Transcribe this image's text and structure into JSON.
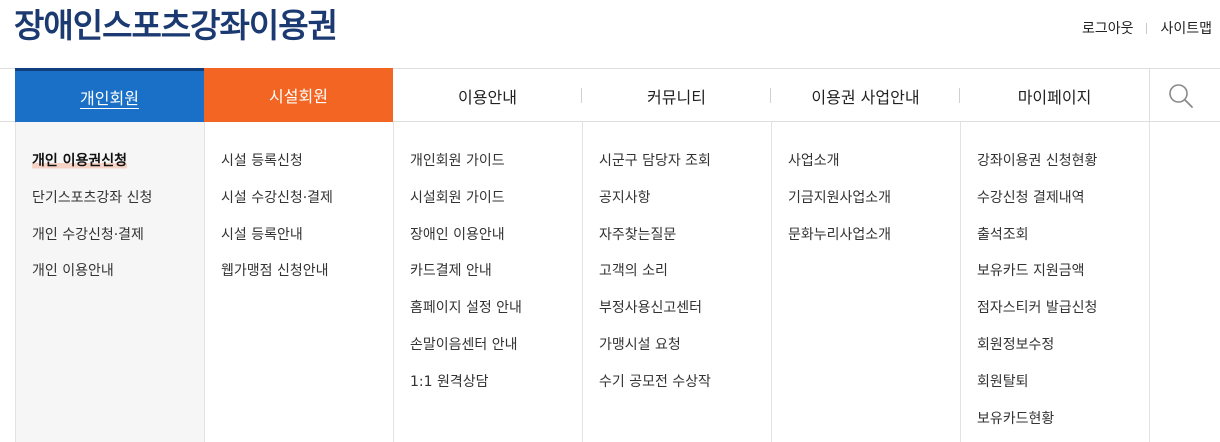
{
  "site_title": "장애인스포츠강좌이용권",
  "util_links": [
    "로그아웃",
    "사이트맵"
  ],
  "nav": {
    "tabs": [
      "개인회원",
      "시설회원",
      "이용안내",
      "커뮤니티",
      "이용권 사업안내",
      "마이페이지"
    ],
    "active_tab": "개인회원",
    "colors": {
      "personal": "#1a70c6",
      "facility": "#f26522",
      "site_title": "#1c3a72"
    }
  },
  "menu": {
    "personal": [
      "개인 이용권신청",
      "단기스포츠강좌 신청",
      "개인 수강신청·결제",
      "개인 이용안내"
    ],
    "facility": [
      "시설 등록신청",
      "시설 수강신청·결제",
      "시설 등록안내",
      "웹가맹점 신청안내"
    ],
    "guide": [
      "개인회원 가이드",
      "시설회원 가이드",
      "장애인 이용안내",
      "카드결제 안내",
      "홈페이지 설정 안내",
      "손말이음센터 안내",
      "1:1 원격상담"
    ],
    "community": [
      "시군구 담당자 조회",
      "공지사항",
      "자주찾는질문",
      "고객의 소리",
      "부정사용신고센터",
      "가맹시설 요청",
      "수기 공모전 수상작"
    ],
    "business": [
      "사업소개",
      "기금지원사업소개",
      "문화누리사업소개"
    ],
    "mypage": [
      "강좌이용권 신청현황",
      "수강신청 결제내역",
      "출석조회",
      "보유카드 지원금액",
      "점자스티커 발급신청",
      "회원정보수정",
      "회원탈퇴",
      "보유카드현황"
    ],
    "active_item": "개인 이용권신청"
  },
  "icons": {
    "search": "search-icon"
  }
}
